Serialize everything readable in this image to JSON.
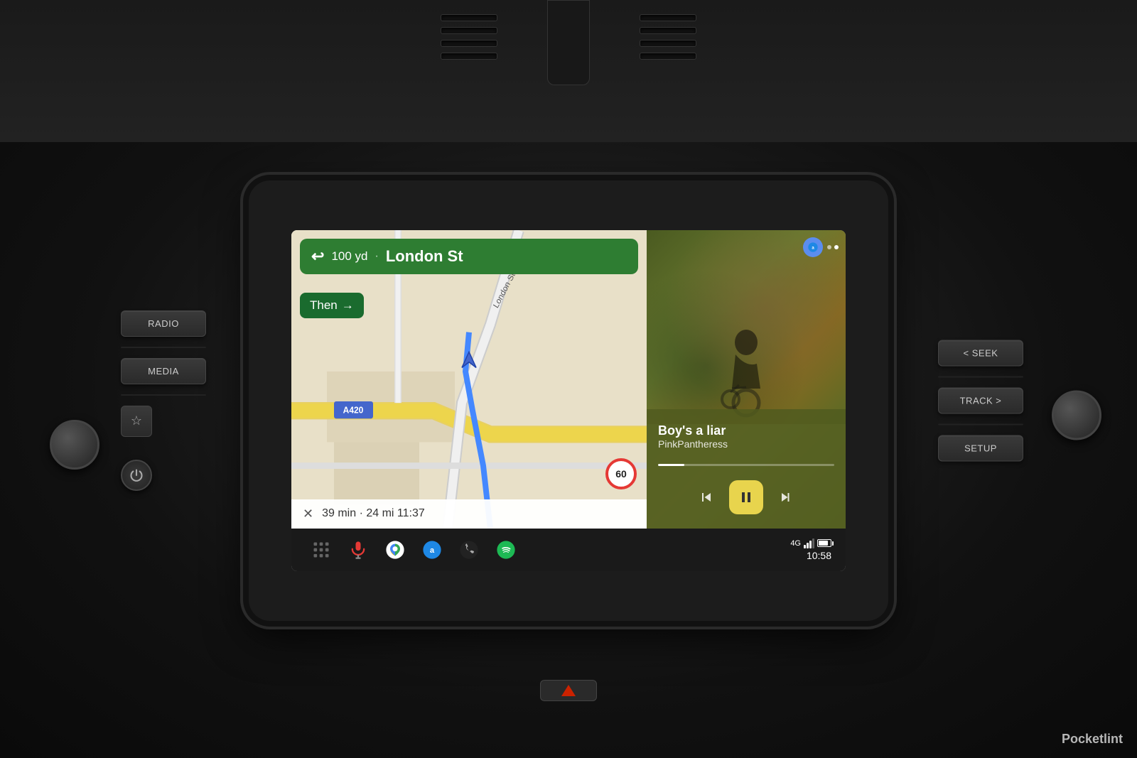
{
  "dashboard": {
    "background_color": "#1a1a1a"
  },
  "left_panel": {
    "radio_label": "RADIO",
    "media_label": "MEDIA",
    "star_icon": "☆"
  },
  "right_panel": {
    "seek_label": "< SEEK",
    "track_label": "TRACK >",
    "setup_label": "SETUP"
  },
  "screen": {
    "navigation": {
      "distance": "100 yd",
      "street": "London St",
      "then_label": "Then",
      "then_arrow": "→",
      "turn_arrow": "↩",
      "route_summary": "39 min · 24 mi  11:37",
      "close_icon": "✕",
      "speed_limit": "60"
    },
    "media": {
      "song_title": "Boy's a liar",
      "artist": "PinkPantheress",
      "progress_percent": 15,
      "dots": [
        {
          "active": false
        },
        {
          "active": true
        }
      ]
    },
    "bottom_nav": {
      "apps_icon": "⠿",
      "mic_icon": "🎤",
      "time": "10:58",
      "signal_label": "4G"
    }
  },
  "watermark": {
    "brand": "Pocket",
    "brand_bold": "lint"
  }
}
